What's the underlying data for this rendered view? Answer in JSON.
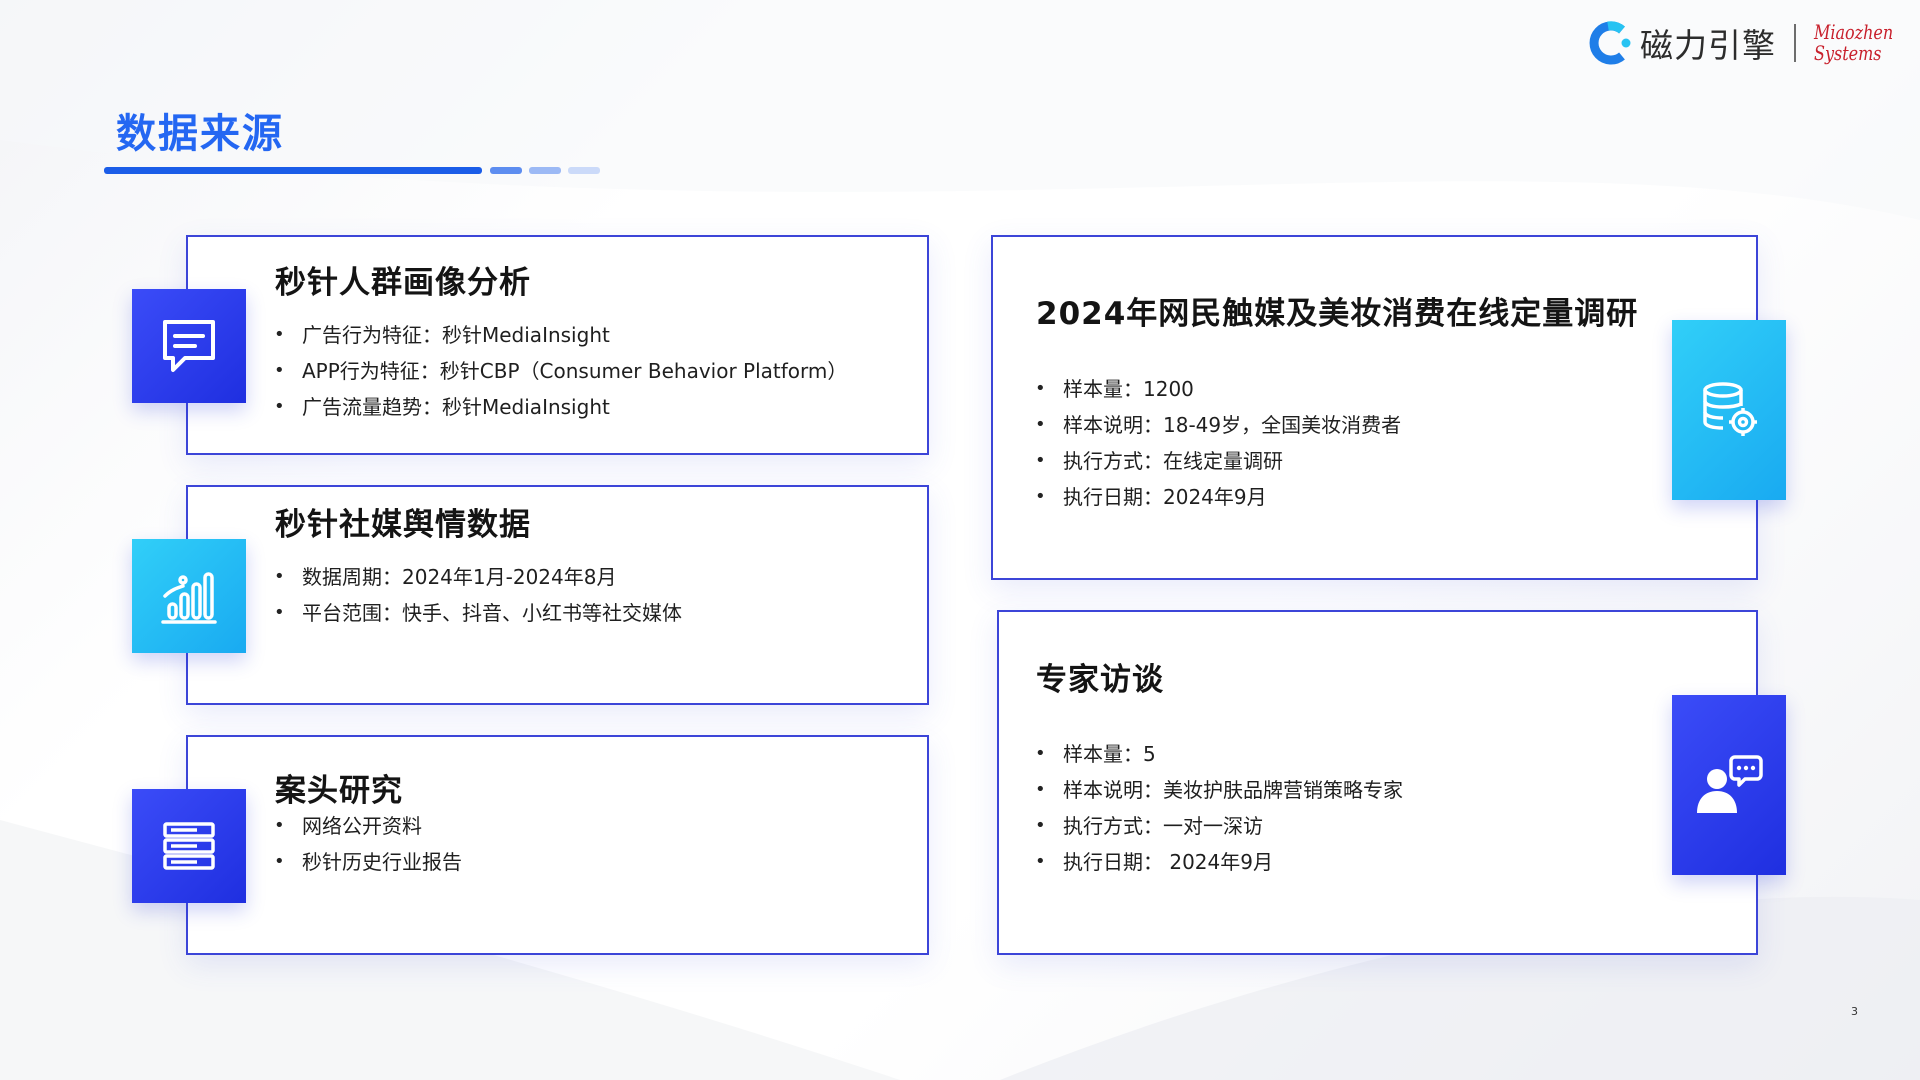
{
  "brand": {
    "name_cn": "磁力引擎",
    "name_en_line1": "Miaozhen",
    "name_en_line2": "Systems"
  },
  "page": {
    "title": "数据来源",
    "page_number": "3"
  },
  "cards": {
    "crowd_profile": {
      "title": "秒针人群画像分析",
      "icon": "message-square-icon",
      "bullets": [
        "广告行为特征：秒针MediaInsight",
        "APP行为特征：秒针CBP（Consumer Behavior Platform）",
        "广告流量趋势：秒针MediaInsight"
      ]
    },
    "social_media": {
      "title": "秒针社媒舆情数据",
      "icon": "bar-chart-signal-icon",
      "bullets": [
        "数据周期：2024年1月-2024年8月",
        "平台范围：快手、抖音、小红书等社交媒体"
      ]
    },
    "desk_research": {
      "title": "案头研究",
      "icon": "stacked-documents-icon",
      "bullets": [
        "网络公开资料",
        "秒针历史行业报告"
      ]
    },
    "survey": {
      "title": "2024年网民触媒及美妆消费在线定量调研",
      "icon": "database-settings-icon",
      "bullets": [
        "样本量：1200",
        "样本说明：18-49岁，全国美妆消费者",
        "执行方式：在线定量调研",
        "执行日期：2024年9月"
      ]
    },
    "expert_interview": {
      "title": "专家访谈",
      "icon": "person-chat-icon",
      "bullets": [
        "样本量：5",
        "样本说明：美妆护肤品牌营销策略专家",
        "执行方式：一对一深访",
        "执行日期： 2024年9月"
      ]
    }
  },
  "colors": {
    "title_blue": "#2467f2",
    "card_border": "#3c45d8",
    "tile_indigo": "#2a3cf0",
    "tile_cyan": "#22bdf5",
    "brand_red": "#c8202c"
  }
}
